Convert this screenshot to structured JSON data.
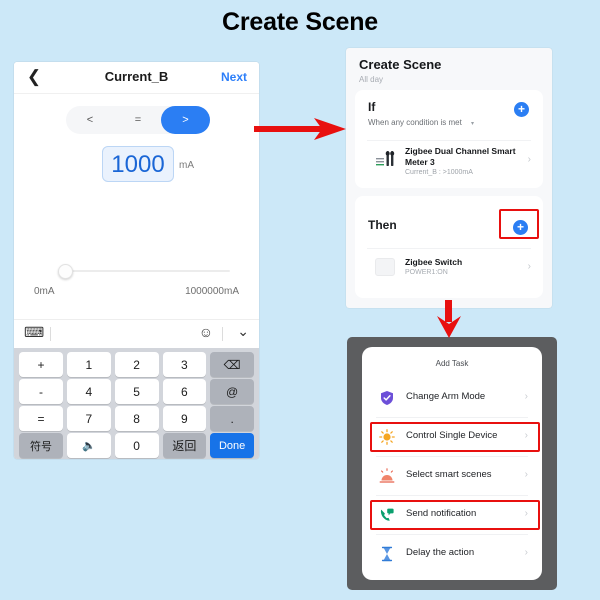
{
  "page": {
    "title": "Create Scene",
    "background": "#cce8f8"
  },
  "colors": {
    "accent_blue": "#2b7ef3",
    "highlight_red": "#e8100f",
    "arrow_red": "#e8100f",
    "value_blue": "#1a66d6"
  },
  "left_phone": {
    "navbar": {
      "back_icon": "chevron-left-icon",
      "title": "Current_B",
      "next_label": "Next"
    },
    "comparison": {
      "options": [
        "<",
        "=",
        ">"
      ],
      "selected": ">"
    },
    "value": {
      "number": "1000",
      "unit": "mA"
    },
    "slider": {
      "min_label": "0mA",
      "max_label": "1000000mA",
      "position_percent": 0
    },
    "keyboard_toolbar": {
      "left_icon": "keyboard-switch-icon",
      "emoji_icon": "emoji-icon",
      "collapse_icon": "chevron-down-icon"
    },
    "keyboard": {
      "rows": [
        {
          "op": "+",
          "keys": [
            "1",
            "2",
            "3"
          ],
          "action": "backspace-icon"
        },
        {
          "op": "-",
          "keys": [
            "4",
            "5",
            "6"
          ],
          "action": "@"
        },
        {
          "op": "=",
          "keys": [
            "7",
            "8",
            "9"
          ],
          "action": "."
        },
        {
          "op": "/",
          "keys": [],
          "action": ""
        }
      ],
      "ops": [
        "+",
        "-",
        "=",
        "/"
      ],
      "digits_r1": [
        "1",
        "2",
        "3"
      ],
      "digits_r2": [
        "4",
        "5",
        "6"
      ],
      "digits_r3": [
        "7",
        "8",
        "9"
      ],
      "right_r1": "backspace-icon",
      "right_r2": "@",
      "right_r3": ".",
      "bottom": {
        "symbols": "符号",
        "mic": "mic-icon",
        "zero": "0",
        "return": "返回",
        "done": "Done"
      }
    }
  },
  "mid_phone": {
    "title": "Create Scene",
    "subtitle": "All day",
    "if_card": {
      "label": "If",
      "condition": "When any condition is met",
      "condition_caret": "▾",
      "add_icon": "plus-circle-icon",
      "device": {
        "icon": "energy-meter-icon",
        "name": "Zigbee Dual Channel Smart Meter 3",
        "meta": "Current_B : >1000mA",
        "chevron": "›"
      }
    },
    "then_card": {
      "label": "Then",
      "add_icon": "plus-circle-icon",
      "highlighted": true,
      "action": {
        "icon": "switch-icon",
        "name": "Zigbee Switch",
        "meta": "POWER1:ON",
        "chevron": "›"
      }
    }
  },
  "bottom_phone": {
    "header": "Add Task",
    "items": [
      {
        "icon": "shield-check-icon",
        "label": "Change Arm Mode",
        "chevron": "›",
        "highlighted": false
      },
      {
        "icon": "bulb-icon",
        "label": "Control Single Device",
        "chevron": "›",
        "highlighted": true
      },
      {
        "icon": "smart-scene-icon",
        "label": "Select smart scenes",
        "chevron": "›",
        "highlighted": false
      },
      {
        "icon": "phone-message-icon",
        "label": "Send notification",
        "chevron": "›",
        "highlighted": true
      },
      {
        "icon": "hourglass-icon",
        "label": "Delay the action",
        "chevron": "›",
        "highlighted": false
      }
    ]
  },
  "arrows": [
    {
      "name": "arrow-right",
      "direction": "right"
    },
    {
      "name": "arrow-down",
      "direction": "down"
    }
  ]
}
